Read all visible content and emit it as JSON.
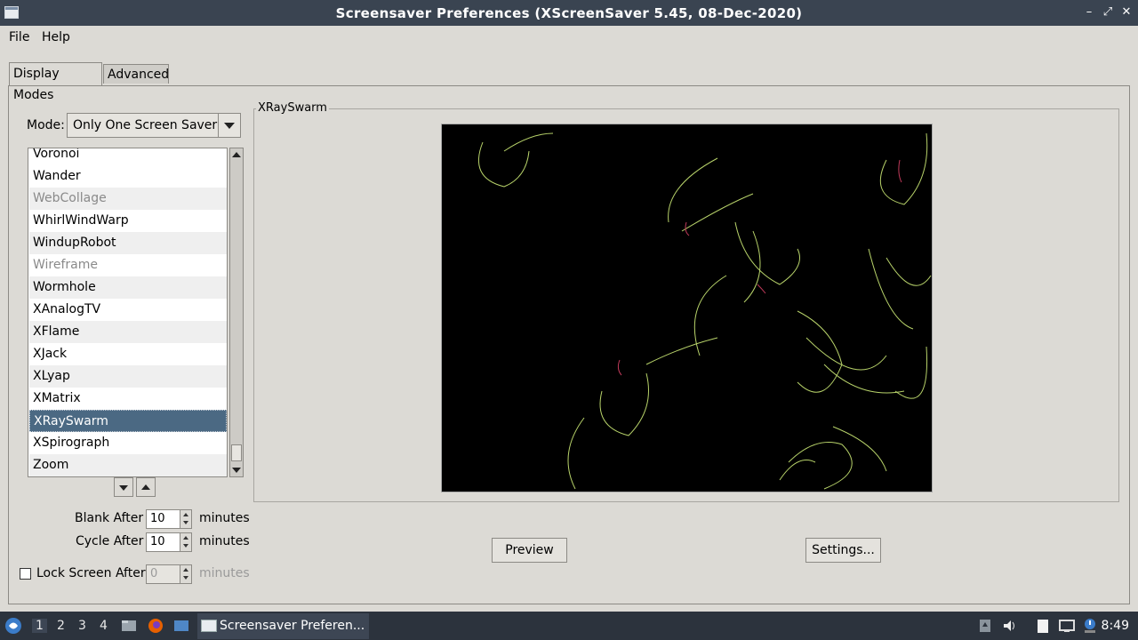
{
  "window": {
    "title": "Screensaver Preferences  (XScreenSaver 5.45, 08-Dec-2020)"
  },
  "menu": {
    "file": "File",
    "help": "Help"
  },
  "tabs": [
    {
      "label": "Display Modes"
    },
    {
      "label": "Advanced"
    }
  ],
  "mode": {
    "label": "Mode:",
    "value": "Only One Screen Saver"
  },
  "savers": [
    {
      "label": "Voronoi",
      "state": "normal"
    },
    {
      "label": "Wander",
      "state": "normal"
    },
    {
      "label": "WebCollage",
      "state": "disabled"
    },
    {
      "label": "WhirlWindWarp",
      "state": "normal"
    },
    {
      "label": "WindupRobot",
      "state": "normal"
    },
    {
      "label": "Wireframe",
      "state": "disabled"
    },
    {
      "label": "Wormhole",
      "state": "normal"
    },
    {
      "label": "XAnalogTV",
      "state": "normal"
    },
    {
      "label": "XFlame",
      "state": "normal"
    },
    {
      "label": "XJack",
      "state": "normal"
    },
    {
      "label": "XLyap",
      "state": "normal"
    },
    {
      "label": "XMatrix",
      "state": "normal"
    },
    {
      "label": "XRaySwarm",
      "state": "selected"
    },
    {
      "label": "XSpirograph",
      "state": "normal"
    },
    {
      "label": "Zoom",
      "state": "normal"
    }
  ],
  "timing": {
    "blank_label": "Blank After",
    "blank_value": "10",
    "cycle_label": "Cycle After",
    "cycle_value": "10",
    "lock_label": "Lock Screen After",
    "lock_value": "0",
    "unit": "minutes"
  },
  "preview": {
    "frame_title": "XRaySwarm",
    "preview_button": "Preview",
    "settings_button": "Settings..."
  },
  "taskbar": {
    "workspaces": [
      "1",
      "2",
      "3",
      "4"
    ],
    "task_label": "Screensaver Preferen...",
    "clock": "8:49"
  },
  "colors": {
    "selection": "#4b6983",
    "titlebar": "#3a4451",
    "taskbar": "#2c333d"
  }
}
